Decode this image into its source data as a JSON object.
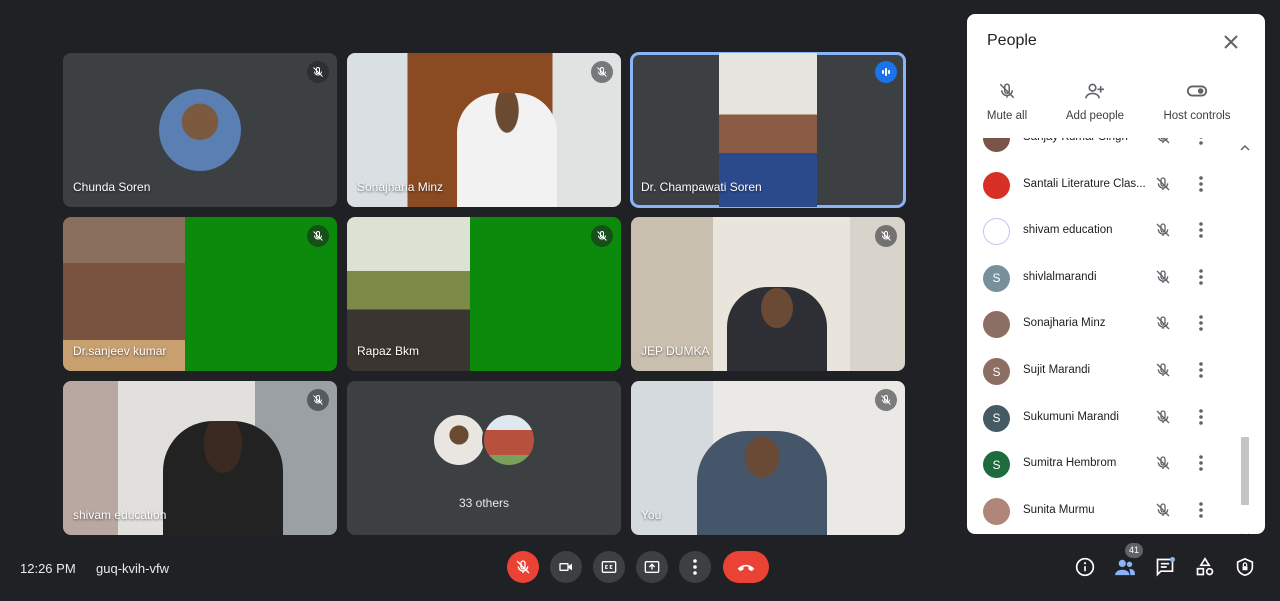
{
  "tiles": [
    {
      "name": "Chunda Soren"
    },
    {
      "name": "Sonajharia Minz"
    },
    {
      "name": "Dr. Champawati Soren"
    },
    {
      "name": "Dr.sanjeev kumar"
    },
    {
      "name": "Rapaz Bkm"
    },
    {
      "name": "JEP DUMKA"
    },
    {
      "name": "shivam education"
    },
    {
      "name": "You"
    }
  ],
  "others": {
    "label": "33 others"
  },
  "panel": {
    "title": "People",
    "actions": {
      "mute_all": "Mute all",
      "add_people": "Add people",
      "host_controls": "Host controls"
    },
    "participants": [
      {
        "name": "Sanjay Kumar Singh",
        "initial": "",
        "color": "#795548"
      },
      {
        "name": "Santali Literature Clas...",
        "initial": "",
        "color": "#d93025"
      },
      {
        "name": "shivam education",
        "initial": "",
        "color": "#ffffff"
      },
      {
        "name": "shivlalmarandi",
        "initial": "S",
        "color": "#78909c"
      },
      {
        "name": "Sonajharia Minz",
        "initial": "",
        "color": "#8d6e63"
      },
      {
        "name": "Sujit Marandi",
        "initial": "S",
        "color": "#8d6e63"
      },
      {
        "name": "Sukumuni Marandi",
        "initial": "S",
        "color": "#455a64"
      },
      {
        "name": "Sumitra Hembrom",
        "initial": "S",
        "color": "#1e6b3c"
      },
      {
        "name": "Sunita Murmu",
        "initial": "",
        "color": "#b0857a"
      }
    ]
  },
  "bottom": {
    "time": "12:26 PM",
    "meeting_code": "guq-kvih-vfw",
    "people_count": "41"
  },
  "colors": {
    "accent": "#1a73e8",
    "end_call": "#ea4335",
    "background": "#202124",
    "tile": "#3c4043"
  }
}
